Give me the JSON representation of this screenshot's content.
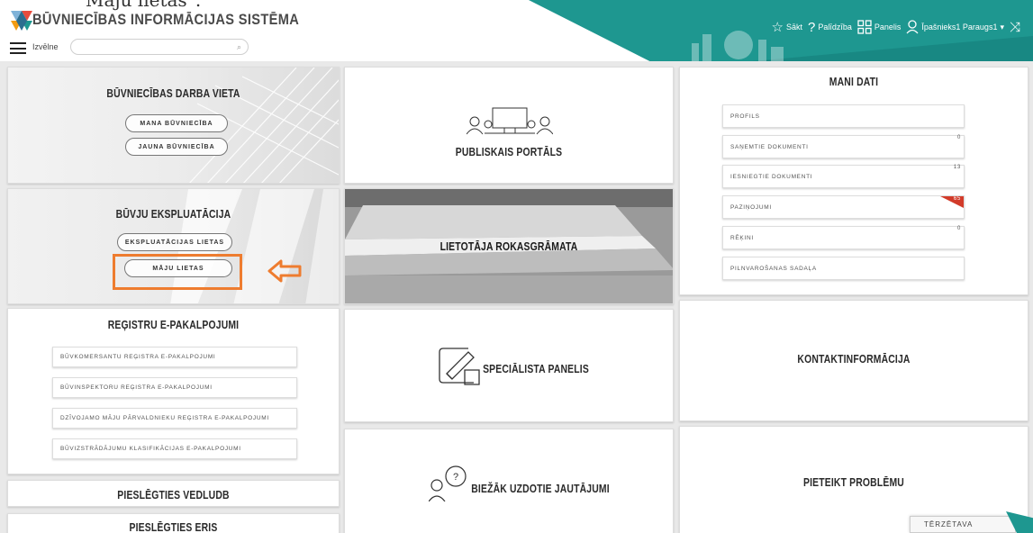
{
  "header": {
    "crop_text": "Māju lietas\".",
    "app_title": "BŪVNIECĪBAS INFORMĀCIJAS SISTĒMA",
    "menu_label": "Izvēlne",
    "nav": {
      "start": "Sākt",
      "help": "Palīdzība",
      "panel": "Panelis",
      "user": "Īpašnieks1 Paraugs1"
    }
  },
  "cards": {
    "buvniecibas": {
      "title": "BŪVNIECĪBAS DARBA VIETA",
      "btn_mana": "MANA BŪVNIECĪBA",
      "btn_jauna": "JAUNA BŪVNIECĪBA"
    },
    "ekspluatacija": {
      "title": "BŪVJU EKSPLUATĀCIJA",
      "btn_lietas": "EKSPLUATĀCIJAS LIETAS",
      "btn_maju": "MĀJU LIETAS"
    },
    "portals": {
      "title": "PUBLISKAIS PORTĀLS"
    },
    "rokasgramata": {
      "title": "LIETOTĀJA ROKASGRĀMATA"
    },
    "specialista": {
      "title": "SPECIĀLISTA PANELIS"
    },
    "biezak": {
      "title": "BIEŽĀK UZDOTIE JAUTĀJUMI"
    },
    "kontakt": {
      "title": "KONTAKTINFORMĀCIJA"
    },
    "problemu": {
      "title": "PIETEIKT PROBLĒMU"
    },
    "vedludb": {
      "title": "PIESLĒGTIES VEDLUDB"
    },
    "eris": {
      "title": "PIESLĒGTIES ERIS"
    },
    "registri": {
      "title": "REĢISTRU E-PAKALPOJUMI",
      "items": [
        "BŪVKOMERSANTU REĢISTRA E-PAKALPOJUMI",
        "BŪVINSPEKTORU REĢISTRA E-PAKALPOJUMI",
        "DZĪVOJAMO MĀJU PĀRVALDNIEKU REĢISTRA E-PAKALPOJUMI",
        "BŪVIZSTRĀDĀJUMU KLASIFIKĀCIJAS E-PAKALPOJUMI"
      ]
    },
    "mani_dati": {
      "title": "MANI DATI",
      "items": [
        {
          "label": "PROFILS",
          "badge": ""
        },
        {
          "label": "SAŅEMTIE DOKUMENTI",
          "badge": "0"
        },
        {
          "label": "IESNIEGTIE DOKUMENTI",
          "badge": "13"
        },
        {
          "label": "PAZIŅOJUMI",
          "badge": "65"
        },
        {
          "label": "RĒĶINI",
          "badge": "0"
        },
        {
          "label": "PILNVAROŠANAS SADAĻA",
          "badge": ""
        }
      ]
    }
  },
  "feedback": {
    "label": "TĒRZĒTAVA"
  },
  "colors": {
    "teal": "#1e9790",
    "highlight": "#ee7c2f",
    "badge_red": "#d23b2a"
  }
}
